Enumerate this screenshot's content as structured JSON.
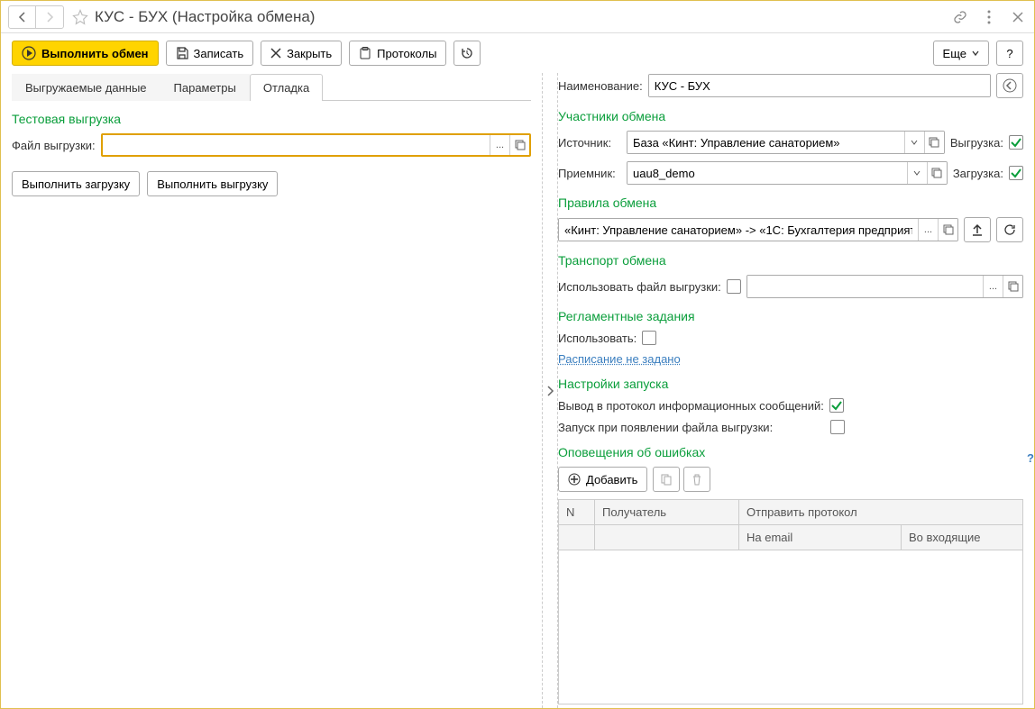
{
  "title": "КУС - БУХ (Настройка обмена)",
  "toolbar": {
    "run": "Выполнить обмен",
    "save": "Записать",
    "close": "Закрыть",
    "protocols": "Протоколы",
    "more": "Еще",
    "help": "?"
  },
  "tabs": {
    "exported": "Выгружаемые данные",
    "params": "Параметры",
    "debug": "Отладка"
  },
  "left": {
    "section": "Тестовая выгрузка",
    "file_label": "Файл выгрузки:",
    "file_value": "",
    "btn_load": "Выполнить загрузку",
    "btn_export": "Выполнить выгрузку"
  },
  "right": {
    "name_label": "Наименование:",
    "name_value": "КУС - БУХ",
    "participants": "Участники обмена",
    "source_label": "Источник:",
    "source_value": "База «Кинт: Управление санаторием»",
    "export_label": "Выгрузка:",
    "dest_label": "Приемник:",
    "dest_value": "uau8_demo",
    "load_label": "Загрузка:",
    "rules": "Правила обмена",
    "rules_value": "«Кинт: Управление санаторием» -> «1С: Бухгалтерия предприят",
    "transport": "Транспорт обмена",
    "use_file": "Использовать файл выгрузки:",
    "scheduled": "Регламентные задания",
    "use_label": "Использовать:",
    "schedule_link": "Расписание не задано",
    "launch": "Настройки запуска",
    "proto_out": "Вывод в протокол информационных сообщений:",
    "launch_on_file": "Запуск при появлении файла выгрузки:",
    "errors": "Оповещения об ошибках",
    "add": "Добавить",
    "table": {
      "col_n": "N",
      "col_recipient": "Получатель",
      "col_send": "Отправить протокол",
      "col_email": "На email",
      "col_inbox": "Во входящие"
    }
  }
}
